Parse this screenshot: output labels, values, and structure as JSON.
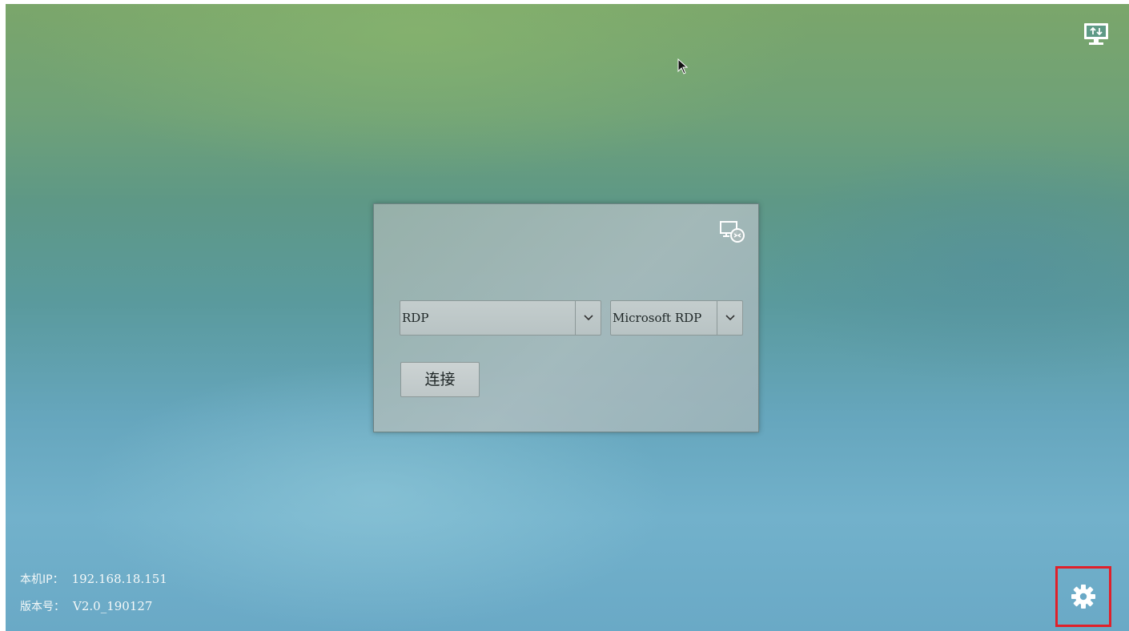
{
  "login_panel": {
    "protocol_select": {
      "value": "RDP"
    },
    "client_select": {
      "value": "Microsoft RDP"
    },
    "connect_label": "连接"
  },
  "info": {
    "ip_label": "本机IP：",
    "ip_value": "192.168.18.151",
    "version_label": "版本号：",
    "version_value": "V2.0_190127"
  },
  "icons": {
    "top_right": "network-monitor-icon",
    "panel": "remote-desktop-icon",
    "settings": "gear-icon",
    "dropdown": "chevron-down-icon"
  },
  "colors": {
    "settings_highlight": "#e0202a",
    "text_light": "#f4f8f8"
  }
}
